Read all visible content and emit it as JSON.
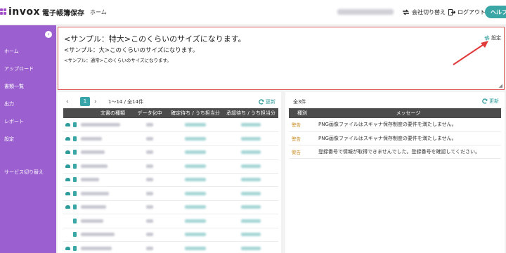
{
  "app": {
    "logo_text": "invox",
    "product_name": "電子帳簿保存",
    "nav_home": "ホーム"
  },
  "header": {
    "switch_company": "会社切り替え",
    "logout": "ログアウト",
    "help": "ヘルプ"
  },
  "sidebar": {
    "items": [
      {
        "label": "ホーム"
      },
      {
        "label": "アップロード"
      },
      {
        "label": "書類一覧"
      },
      {
        "label": "出力"
      },
      {
        "label": "レポート"
      },
      {
        "label": "設定"
      },
      {
        "label": "サービス切り替え"
      }
    ]
  },
  "banner": {
    "line_large": "<サンプル：特大>このくらいのサイズになります。",
    "line_medium": "<サンプル：大>このくらいのサイズになります。",
    "line_small": "<サンプル：通常>このくらいのサイズになります。",
    "settings_label": "設定"
  },
  "list": {
    "page": "1",
    "range_info": "1〜14 / 全14件",
    "refresh_label": "更新",
    "columns": [
      "文書の種類",
      "データ化中",
      "確定待ち / うち担当分",
      "承認待ち / うち担当分"
    ],
    "row_count": 10
  },
  "messages": {
    "count": "全3件",
    "refresh_label": "更新",
    "columns": [
      "種別",
      "メッセージ"
    ],
    "rows": [
      {
        "kind": "警告",
        "message": "PNG画像ファイルはスキャナ保存制度の要件を満たしません。"
      },
      {
        "kind": "警告",
        "message": "PNG画像ファイルはスキャナ保存制度の要件を満たしません。"
      },
      {
        "kind": "警告",
        "message": "登録番号で情報が取得できませんでした。登録番号を確認してください。"
      }
    ]
  },
  "colors": {
    "sidebar": "#9b5fd0",
    "accent_teal": "#36a4a8",
    "highlight_border": "#e05a5a",
    "annotation_arrow": "#e03a3a",
    "warning": "#c98a1e"
  }
}
